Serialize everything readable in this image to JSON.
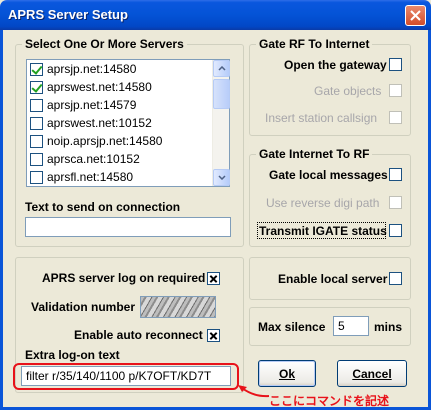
{
  "window": {
    "title": "APRS Server Setup"
  },
  "servers": {
    "group_title": "Select One Or More Servers",
    "items": [
      {
        "label": "aprsjp.net:14580",
        "checked": true
      },
      {
        "label": "aprswest.net:14580",
        "checked": true
      },
      {
        "label": "aprsjp.net:14579",
        "checked": false
      },
      {
        "label": "aprswest.net:10152",
        "checked": false
      },
      {
        "label": "noip.aprsjp.net:14580",
        "checked": false
      },
      {
        "label": "aprsca.net:10152",
        "checked": false
      },
      {
        "label": "aprsfl.net:14580",
        "checked": false
      }
    ],
    "send_label": "Text to send on connection",
    "send_value": ""
  },
  "gate_rf": {
    "title": "Gate RF To Internet",
    "open_gateway": "Open the gateway",
    "gate_objects": "Gate objects",
    "insert_callsign": "Insert station callsign"
  },
  "gate_inet": {
    "title": "Gate Internet To RF",
    "gate_local": "Gate local messages",
    "reverse_digi": "Use reverse digi path",
    "transmit_igate": "Transmit IGATE status"
  },
  "log": {
    "required_label": "APRS server log on required",
    "validation_label": "Validation number",
    "auto_reconnect_label": "Enable auto reconnect",
    "extra_label": "Extra log-on text",
    "extra_value": "filter r/35/140/1100 p/K7OFT/KD7T"
  },
  "local_server": {
    "label": "Enable local server"
  },
  "silence": {
    "label": "Max silence",
    "value": "5",
    "unit": "mins"
  },
  "buttons": {
    "ok": "Ok",
    "cancel": "Cancel"
  },
  "annotation": {
    "text": "ここにコマンドを記述"
  },
  "colors": {
    "title_bar": "#0453d6",
    "annotation": "#e8121a",
    "dialog": "#ece9d8"
  }
}
